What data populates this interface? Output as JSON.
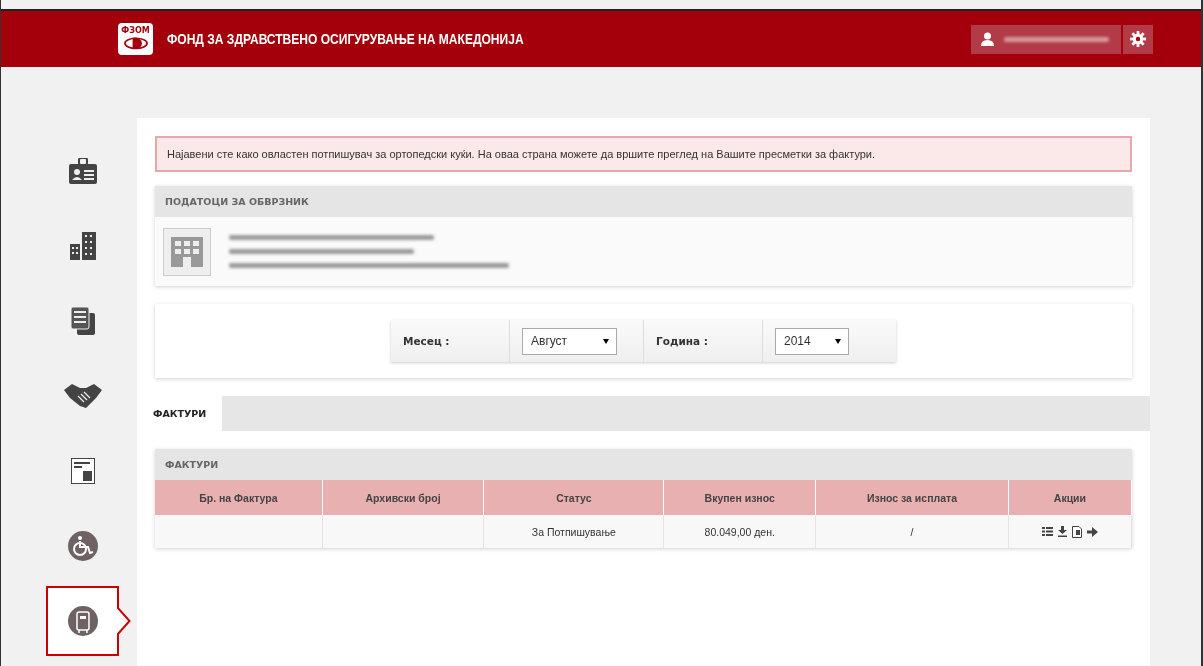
{
  "header": {
    "logo_text": "ФЗОМ",
    "title": "ФОНД ЗА ЗДРАВСТВЕНО ОСИГУРУВАЊЕ НА МАКЕДОНИЈА"
  },
  "sidebar": {
    "items": [
      {
        "kind": "badge",
        "selected": false
      },
      {
        "kind": "buildings",
        "selected": false
      },
      {
        "kind": "documents",
        "selected": false
      },
      {
        "kind": "handshake",
        "selected": false
      },
      {
        "kind": "invoice",
        "selected": false
      },
      {
        "kind": "wheelchair",
        "selected": false
      },
      {
        "kind": "device",
        "selected": true
      }
    ]
  },
  "alert": "Најавени сте како овластен потпишувач за ортопедски куќи. На оваа страна можете да вршите преглед на Вашите пресметки за фактури.",
  "taxpayer": {
    "title": "ПОДАТОЦИ ЗА ОБВРЗНИК"
  },
  "filter": {
    "month": {
      "label": "Месец :",
      "value": "Август"
    },
    "year": {
      "label": "Година :",
      "value": "2014"
    }
  },
  "tabs": [
    {
      "label": "ФАКТУРИ",
      "selected": true
    }
  ],
  "invoices": {
    "title": "ФАКТУРИ",
    "columns": [
      "Бр. на Фактура",
      "Архивски број",
      "Статус",
      "Вкупен износ",
      "Износ за исплата",
      "Акции"
    ],
    "rows": [
      {
        "cells": [
          "",
          "",
          "За Потпишување",
          "80.049,00 ден.",
          "/"
        ],
        "actions": [
          {
            "kind": "list"
          },
          {
            "kind": "download"
          },
          {
            "kind": "file"
          },
          {
            "kind": "arrow"
          }
        ]
      }
    ]
  }
}
